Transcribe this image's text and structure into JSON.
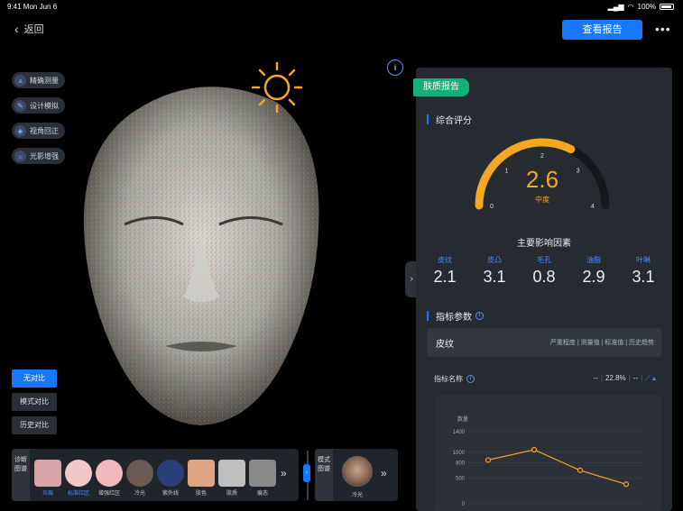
{
  "status": {
    "time": "9:41  Mon Jun 6",
    "battery": "100%"
  },
  "header": {
    "back_label": "返回",
    "report_button": "查看报告",
    "more": "•••"
  },
  "tools": [
    {
      "label": "精确测量",
      "icon": "ruler-icon",
      "glyph": "⩓"
    },
    {
      "label": "设计模拟",
      "icon": "pen-icon",
      "glyph": "✎"
    },
    {
      "label": "视角回正",
      "icon": "reset-view-icon",
      "glyph": "◈"
    },
    {
      "label": "光影增强",
      "icon": "light-icon",
      "glyph": "☼"
    }
  ],
  "compare": [
    {
      "label": "无对比",
      "active": true
    },
    {
      "label": "模式对比",
      "active": false
    },
    {
      "label": "历史对比",
      "active": false
    }
  ],
  "diagnosis": {
    "title": "诊断图谱",
    "items": [
      {
        "label": "炎瘢",
        "active": true,
        "color": "#d7a3a6",
        "round": false
      },
      {
        "label": "标准红区",
        "active": true,
        "color": "#f2c7c7",
        "round": true
      },
      {
        "label": "增强红区",
        "active": false,
        "color": "#f0b9bd",
        "round": true
      },
      {
        "label": "冷光",
        "active": false,
        "color": "#6b5a52",
        "round": true
      },
      {
        "label": "紫外线",
        "active": false,
        "color": "#2a3f7a",
        "round": true
      },
      {
        "label": "肤色",
        "active": false,
        "color": "#e0a483",
        "round": false
      },
      {
        "label": "肤质",
        "active": false,
        "color": "#bfbfbf",
        "round": false
      },
      {
        "label": "痕态",
        "active": false,
        "color": "#8a8a8a",
        "round": false
      }
    ],
    "more": "»"
  },
  "mode": {
    "title": "模式图谱",
    "label": "冷光",
    "more": "»"
  },
  "panel": {
    "tag": "肤质报告",
    "overall_title": "综合评分",
    "score": "2.6",
    "level": "中度",
    "gauge_ticks": [
      "0",
      "1",
      "2",
      "3",
      "4"
    ],
    "gauge_value": 2.6,
    "gauge_max": 4,
    "accent": "#f5a623",
    "factors_title": "主要影响因素",
    "factors": [
      {
        "name": "皮纹",
        "value": "2.1"
      },
      {
        "name": "皮凸",
        "value": "3.1"
      },
      {
        "name": "毛孔",
        "value": "0.8"
      },
      {
        "name": "油脂",
        "value": "2.9"
      },
      {
        "name": "叶啉",
        "value": "3.1"
      }
    ],
    "params_title": "指标参数",
    "metric": {
      "name": "皮纹",
      "columns": "严重程度 | 测量值 | 标准值 | 历史趋势"
    },
    "indicator": {
      "name": "指标名称",
      "v1": "--",
      "v2": "22.8%",
      "v3": "--"
    }
  },
  "chart_data": {
    "type": "line",
    "ylabel": "数量",
    "yticks": [
      0,
      500,
      800,
      1000,
      1400
    ],
    "ylim": [
      0,
      1400
    ],
    "series": [
      {
        "values": [
          850,
          1050,
          650,
          380
        ]
      }
    ],
    "color": "#f5a623"
  }
}
